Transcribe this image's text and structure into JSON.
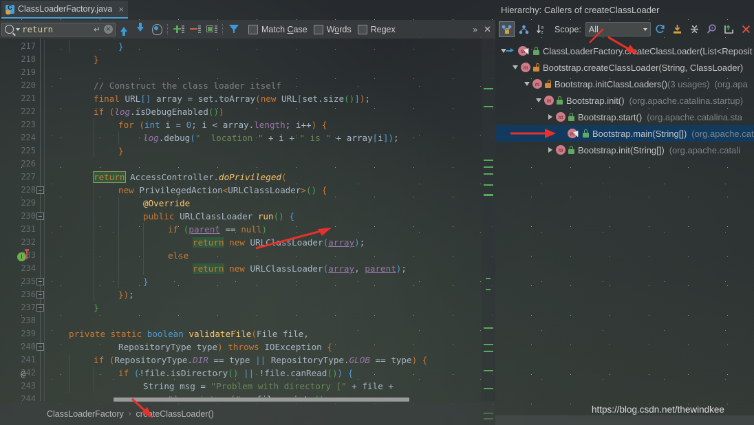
{
  "editor": {
    "tab": {
      "title": "ClassLoaderFactory.java",
      "close": "×",
      "icon": "java-class-icon"
    },
    "search": {
      "value": "return",
      "enter_icon": "↵",
      "clear_icon": "×",
      "prev_label": "Previous Occurrence",
      "next_label": "Next Occurrence",
      "select_all_label": "Select All Occurrences",
      "add_label": "Add Line",
      "remove_label": "Remove Line",
      "toggle_label": "Toggle Line",
      "filter_label": "Filter",
      "match_case": "Match Case",
      "match_case_prefix": "Match ",
      "match_case_key": "C",
      "match_case_suffix": "ase",
      "words_prefix": "W",
      "words_key": "o",
      "words_suffix": "rds",
      "regex_prefix": "Re",
      "regex_key": "g",
      "regex_suffix": "ex",
      "more_icon": "»",
      "close_icon": "✕"
    },
    "line_start": 217,
    "line_end": 244,
    "breadcrumb": {
      "class": "ClassLoaderFactory",
      "separator": "›",
      "method": "createClassLoader()"
    },
    "lines": [
      {
        "n": 217,
        "html": "<span class=\"ind\" style=\"left:0px;height:19px\"></span><span class=\"ind\" style=\"left:36px;height:19px\"></span><span style=\"padding-left:108px\"><span class=\"brB\">}</span></span>"
      },
      {
        "n": 218,
        "html": "<span class=\"ind\" style=\"left:0px;height:19px\"></span><span style=\"padding-left:72px\"><span class=\"brO\">}</span></span>"
      },
      {
        "n": 219,
        "html": "<span class=\"ind\" style=\"left:0px;height:19px\"></span>"
      },
      {
        "n": 220,
        "html": "<span class=\"ind\" style=\"left:0px;height:19px\"></span><span style=\"padding-left:72px\"><span class=\"cmt\">// Construct the class loader itself</span></span>"
      },
      {
        "n": 221,
        "html": "<span class=\"ind\" style=\"left:0px;height:19px\"></span><span style=\"padding-left:72px\"><span class=\"kw\">final</span> <span class=\"typ\">URL</span><span class=\"brB\">[]</span> <span class=\"txt\">array = set.</span><span class=\"txt\">toArray</span><span class=\"brO\">(</span><span class=\"kw\">new</span> <span class=\"typ\">URL</span><span class=\"brB\">[</span><span class=\"txt\">set.size</span><span class=\"brG\">()</span><span class=\"brB\">]</span><span class=\"brO\">)</span><span class=\"txt\">;</span></span>"
      },
      {
        "n": 222,
        "html": "<span class=\"ind\" style=\"left:0px;height:19px\"></span><span style=\"padding-left:72px\"><span class=\"kw\">if</span> <span class=\"brO\">(</span><span class=\"stat\">log</span><span class=\"txt\">.isDebugEnabled</span><span class=\"brG\">()</span><span class=\"brO\">)</span></span>"
      },
      {
        "n": 223,
        "html": "<span class=\"ind\" style=\"left:0px;height:19px\"></span><span class=\"ind\" style=\"left:72px;height:19px\"></span><span style=\"padding-left:108px\"><span class=\"kw\">for</span> <span class=\"brO\">(</span><span class=\"kw2\">int</span> <span class=\"txt\">i = </span><span class=\"num\">0</span><span class=\"txt\">; i &lt; array.</span><span class=\"fld\">length</span><span class=\"txt\">; i++</span><span class=\"brO\">)</span> <span class=\"brO\">{</span></span>"
      },
      {
        "n": 224,
        "html": "<span class=\"ind\" style=\"left:0px;height:19px\"></span><span class=\"ind\" style=\"left:72px;height:19px\"></span><span class=\"ind\" style=\"left:108px;height:19px\"></span><span style=\"padding-left:144px\"><span class=\"stat\">log</span><span class=\"txt\">.debug</span><span class=\"brB\">(</span><span class=\"str\">\"  location \"</span><span class=\"txt\"> + i + </span><span class=\"str\">\" is \"</span><span class=\"txt\"> + array</span><span class=\"brB\">[</span><span class=\"txt\">i</span><span class=\"brB\">]</span><span class=\"brB\">)</span><span class=\"txt\">;</span></span>"
      },
      {
        "n": 225,
        "html": "<span class=\"ind\" style=\"left:0px;height:19px\"></span><span class=\"ind\" style=\"left:72px;height:19px\"></span><span style=\"padding-left:108px\"><span class=\"brO\">}</span></span>"
      },
      {
        "n": 226,
        "html": "<span class=\"ind\" style=\"left:0px;height:19px\"></span>"
      },
      {
        "n": 227,
        "html": "<span class=\"ind\" style=\"left:0px;height:19px\"></span><span style=\"padding-left:72px\"><span class=\"hl2\">return</span> <span class=\"typ\">AccessController.</span><span class=\"mth\" style=\"font-style:italic\">doPrivileged</span><span class=\"brO\">(</span></span>"
      },
      {
        "n": 228,
        "html": "<span class=\"ind\" style=\"left:0px;height:19px\"></span><span class=\"ind\" style=\"left:72px;height:19px\"></span><span style=\"padding-left:108px\"><span class=\"kw\">new</span> <span class=\"typ\">PrivilegedAction</span><span class=\"brO\">&lt;</span><span class=\"typ\">URLClassLoader</span><span class=\"brO\">&gt;</span><span class=\"brG\">()</span> <span class=\"brO\">{</span></span>"
      },
      {
        "n": 229,
        "html": "<span class=\"ind\" style=\"left:0px;height:19px\"></span><span class=\"ind\" style=\"left:72px;height:19px\"></span><span class=\"ind\" style=\"left:108px;height:19px\"></span><span style=\"padding-left:144px\"><span class=\"mth\">@Override</span></span>"
      },
      {
        "n": 230,
        "html": "<span class=\"ind\" style=\"left:0px;height:19px\"></span><span class=\"ind\" style=\"left:72px;height:19px\"></span><span class=\"ind\" style=\"left:108px;height:19px\"></span><span style=\"padding-left:144px\"><span class=\"kw\">public</span> <span class=\"typ\">URLClassLoader</span> <span class=\"mth\">run</span><span class=\"brG\">()</span> <span class=\"brB\">{</span></span>"
      },
      {
        "n": 231,
        "html": "<span class=\"ind\" style=\"left:0px;height:19px\"></span><span class=\"ind\" style=\"left:72px;height:19px\"></span><span class=\"ind\" style=\"left:108px;height:19px\"></span><span class=\"ind\" style=\"left:144px;height:19px\"></span><span style=\"padding-left:180px\"><span class=\"kw\">if</span> <span class=\"brG\">(</span><span class=\"und\">parent</span><span class=\"txt\"> == </span><span class=\"kw\">null</span><span class=\"brG\">)</span></span>"
      },
      {
        "n": 232,
        "html": "<span class=\"ind\" style=\"left:0px;height:19px\"></span><span class=\"ind\" style=\"left:72px;height:19px\"></span><span class=\"ind\" style=\"left:108px;height:19px\"></span><span class=\"ind\" style=\"left:144px;height:19px\"></span><span style=\"padding-left:216px\"><span class=\"hl\">return</span> <span class=\"kw\">new</span> <span class=\"typ\">URLClassLoader</span><span class=\"brB\">(</span><span class=\"und\">array</span><span class=\"brB\">)</span><span class=\"txt\">;</span></span>"
      },
      {
        "n": 233,
        "html": "<span class=\"ind\" style=\"left:0px;height:19px\"></span><span class=\"ind\" style=\"left:72px;height:19px\"></span><span class=\"ind\" style=\"left:108px;height:19px\"></span><span class=\"ind\" style=\"left:144px;height:19px\"></span><span style=\"padding-left:180px\"><span class=\"kw\">else</span></span>"
      },
      {
        "n": 234,
        "html": "<span class=\"ind\" style=\"left:0px;height:19px\"></span><span class=\"ind\" style=\"left:72px;height:19px\"></span><span class=\"ind\" style=\"left:108px;height:19px\"></span><span class=\"ind\" style=\"left:144px;height:19px\"></span><span style=\"padding-left:216px\"><span class=\"hl\">return</span> <span class=\"kw\">new</span> <span class=\"typ\">URLClassLoader</span><span class=\"brB\">(</span><span class=\"und\">array</span><span class=\"txt\">, </span><span class=\"und\">parent</span><span class=\"brB\">)</span><span class=\"txt\">;</span></span>"
      },
      {
        "n": 235,
        "html": "<span class=\"ind\" style=\"left:0px;height:19px\"></span><span class=\"ind\" style=\"left:72px;height:19px\"></span><span class=\"ind\" style=\"left:108px;height:19px\"></span><span style=\"padding-left:144px\"><span class=\"brB\">}</span></span>"
      },
      {
        "n": 236,
        "html": "<span class=\"ind\" style=\"left:0px;height:19px\"></span><span class=\"ind\" style=\"left:72px;height:19px\"></span><span style=\"padding-left:108px\"><span class=\"brO\">})</span><span class=\"txt\">;</span></span>"
      },
      {
        "n": 237,
        "html": "<span class=\"ind\" style=\"left:0px;height:19px\"></span><span style=\"padding-left:72px\"><span class=\"brG\">}</span></span>"
      },
      {
        "n": 238,
        "html": "<span class=\"ind\" style=\"left:0px;height:19px\"></span>"
      },
      {
        "n": 239,
        "html": "<span class=\"ind\" style=\"left:0px;height:19px\"></span><span style=\"padding-left:36px\"><span class=\"kw\">private static</span> <span class=\"kw2\">boolean</span> <span class=\"mth\">validateFile</span><span class=\"brO\">(</span><span class=\"typ\">File file,</span></span>"
      },
      {
        "n": 240,
        "html": "<span class=\"ind\" style=\"left:0px;height:19px\"></span><span style=\"padding-left:108px\"><span class=\"typ\">RepositoryType type</span><span class=\"brO\">)</span> <span class=\"kw\">throws</span> <span class=\"typ\">IOException</span> <span class=\"brO\">{</span></span>"
      },
      {
        "n": 241,
        "html": "<span class=\"ind\" style=\"left:0px;height:19px\"></span><span class=\"ind\" style=\"left:36px;height:19px\"></span><span style=\"padding-left:72px\"><span class=\"kw\">if</span> <span class=\"brO\">(</span><span class=\"typ\">RepositoryType.</span><span class=\"fldi\">DIR</span><span class=\"txt\"> == type </span><span class=\"brB\">||</span><span class=\"txt\"> RepositoryType.</span><span class=\"fldi\">GLOB</span><span class=\"txt\"> == type</span><span class=\"brO\">)</span> <span class=\"brO\">{</span></span>"
      },
      {
        "n": 242,
        "html": "<span class=\"ind\" style=\"left:0px;height:19px\"></span><span class=\"ind\" style=\"left:36px;height:19px\"></span><span class=\"ind\" style=\"left:72px;height:19px\"></span><span style=\"padding-left:108px\"><span class=\"kw\">if</span> <span class=\"brB\">(</span><span class=\"txt\">!file.isDirectory</span><span class=\"brG\">()</span><span class=\"txt\"> </span><span class=\"brB\">||</span><span class=\"txt\"> !file.canRead</span><span class=\"brG\">()</span><span class=\"brB\">)</span> <span class=\"brB\">{</span></span>"
      },
      {
        "n": 243,
        "html": "<span class=\"ind\" style=\"left:0px;height:19px\"></span><span class=\"ind\" style=\"left:36px;height:19px\"></span><span class=\"ind\" style=\"left:72px;height:19px\"></span><span style=\"padding-left:144px\"><span class=\"typ\">String msg = </span><span class=\"str\">\"Problem with directory [\"</span><span class=\"txt\"> + file +</span></span>"
      },
      {
        "n": 244,
        "html": "<span class=\"ind\" style=\"left:0px;height:19px\"></span><span style=\"padding-left:180px\"><span class=\"str\">\"], exists: [\"</span><span class=\"txt\"> + file.exists</span><span class=\"brG\">()</span><span class=\"txt\"> +</span></span>"
      }
    ]
  },
  "hierarchy": {
    "title": "Hierarchy: Callers of createClassLoader",
    "toolbar": {
      "callers_label": "Callers Hierarchy",
      "callees_label": "Callees Hierarchy",
      "sort_label": "Sort Alphabetically",
      "scope_label": "Scope:",
      "scope_value": "All",
      "refresh_label": "Refresh",
      "export_label": "Export to Text File",
      "collapse_label": "Collapse All",
      "pin_label": "Pin Tab",
      "autoscroll_label": "Autoscroll to Source",
      "close_label": "Close"
    },
    "rows": [
      {
        "indent": 0,
        "twisty": "down",
        "lock": "green",
        "cursor": true,
        "blue": true,
        "label": "ClassLoaderFactory.createClassLoader(List<Reposit",
        "pkg": "",
        "usages": "",
        "selected": false
      },
      {
        "indent": 1,
        "twisty": "down",
        "lock": "orange",
        "cursor": false,
        "blue": false,
        "label": "Bootstrap.createClassLoader(String, ClassLoader)",
        "pkg": "",
        "usages": "",
        "selected": false
      },
      {
        "indent": 2,
        "twisty": "down",
        "lock": "orange",
        "cursor": false,
        "blue": false,
        "label": "Bootstrap.initClassLoaders()",
        "usages": "(3 usages)",
        "pkg": "(org.apa",
        "selected": false
      },
      {
        "indent": 3,
        "twisty": "down",
        "lock": "green",
        "cursor": false,
        "blue": false,
        "label": "Bootstrap.init()",
        "usages": "",
        "pkg": "(org.apache.catalina.startup)",
        "selected": false
      },
      {
        "indent": 4,
        "twisty": "right",
        "lock": "green",
        "cursor": false,
        "blue": false,
        "label": "Bootstrap.start()",
        "usages": "",
        "pkg": "(org.apache.catalina.sta",
        "selected": false
      },
      {
        "indent": 5,
        "twisty": "none",
        "lock": "green",
        "cursor": true,
        "blue": false,
        "label": "Bootstrap.main(String[])",
        "usages": "",
        "pkg": "(org.apache.cata",
        "selected": true
      },
      {
        "indent": 4,
        "twisty": "right",
        "lock": "green",
        "cursor": false,
        "blue": false,
        "label": "Bootstrap.init(String[])",
        "usages": "",
        "pkg": "(org.apache.catali",
        "selected": false
      }
    ]
  },
  "watermark": "https://blog.csdn.net/thewindkee",
  "colors": {
    "accent_blue": "#4b9fd5",
    "selection_blue": "#123a5e",
    "match_highlight": "#32593d",
    "keyword_orange": "#cc7832",
    "string_green": "#6a8759",
    "arrow_red": "#e8312a"
  }
}
